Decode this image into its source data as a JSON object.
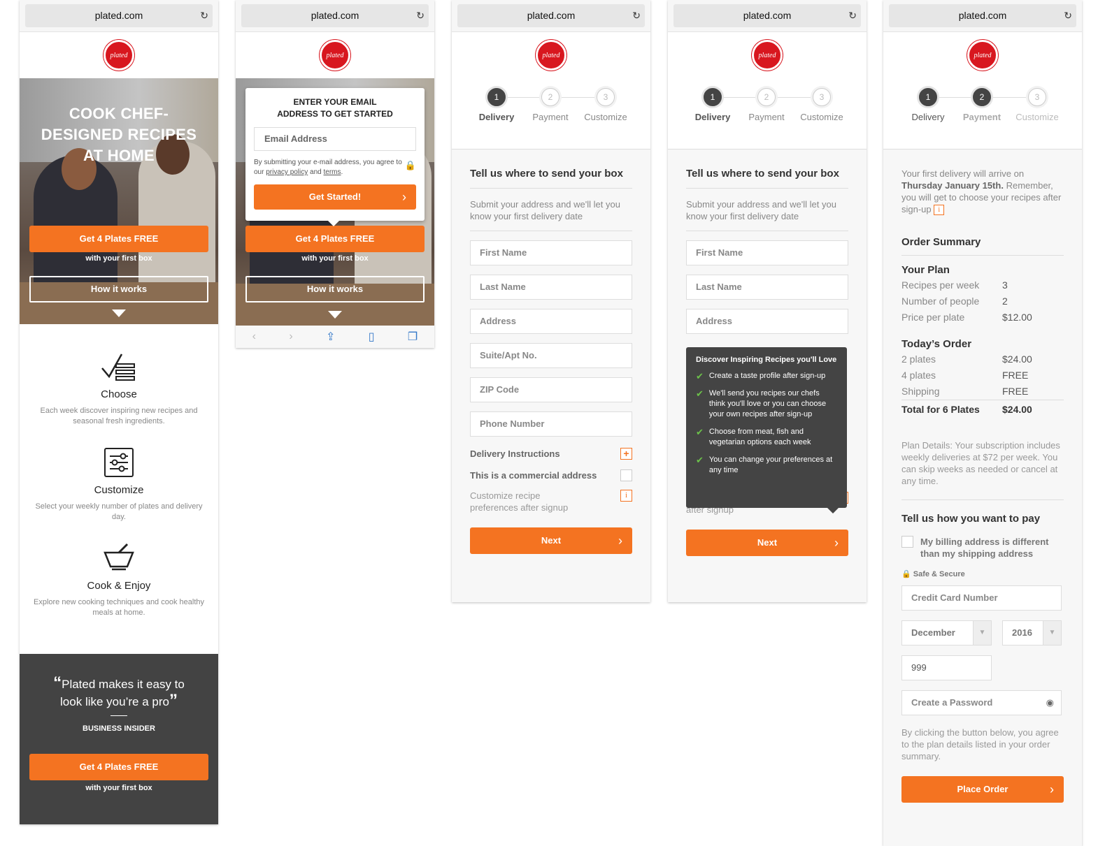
{
  "browser": {
    "url": "plated.com"
  },
  "logo": {
    "text": "plated"
  },
  "landing": {
    "hero_title": "COOK CHEF-DESIGNED RECIPES AT HOME",
    "cta_label": "Get 4 Plates FREE",
    "cta_sub": "with your first box",
    "how_label": "How it works",
    "features": [
      {
        "title": "Choose",
        "desc": "Each week discover inspiring new recipes and seasonal fresh ingredients."
      },
      {
        "title": "Customize",
        "desc": "Select your weekly number of plates and delivery day."
      },
      {
        "title": "Cook & Enjoy",
        "desc": "Explore new cooking techniques and cook healthy meals at home."
      }
    ],
    "quote": "Plated makes it easy to look like you’re a pro",
    "quote_source": "BUSINESS INSIDER"
  },
  "email_modal": {
    "title": "ENTER YOUR EMAIL ADDRESS TO GET STARTED",
    "email_placeholder": "Email Address",
    "legal_prefix": "By submitting your e-mail address, you agree to our",
    "privacy": "privacy policy",
    "and": "and",
    "terms": "terms",
    "go_label": "Get Started!"
  },
  "steps": [
    "Delivery",
    "Payment",
    "Customize"
  ],
  "delivery": {
    "title": "Tell us where to send your box",
    "sub": "Submit your address and we'll let you know your first delivery date",
    "fields": [
      "First Name",
      "Last Name",
      "Address",
      "Suite/Apt No.",
      "ZIP Code",
      "Phone Number"
    ],
    "instructions": "Delivery Instructions",
    "commercial": "This is a commercial address",
    "customize": "Customize recipe preferences after signup",
    "next": "Next"
  },
  "tooltip": {
    "title": "Discover Inspiring Recipes you'll Love",
    "items": [
      "Create a taste profile after sign-up",
      "We'll send you recipes our chefs think you'll love or you can choose your own recipes after sign-up",
      "Choose from meat, fish and vegetarian options each week",
      "You can change your preferences at any time"
    ]
  },
  "payment": {
    "intro_a": "Your first delivery will arrive on",
    "intro_date": "Thursday January 15th.",
    "intro_b": "Remember, you will get to choose your recipes after sign-up",
    "summary_title": "Order Summary",
    "plan_title": "Your Plan",
    "plan": [
      {
        "k": "Recipes per week",
        "v": "3"
      },
      {
        "k": "Number of people",
        "v": "2"
      },
      {
        "k": "Price per plate",
        "v": "$12.00"
      }
    ],
    "order_title": "Today’s Order",
    "order": [
      {
        "k": "2 plates",
        "v": "$24.00"
      },
      {
        "k": "4 plates",
        "v": "FREE"
      },
      {
        "k": "Shipping",
        "v": "FREE"
      }
    ],
    "total_label": "Total for 6 Plates",
    "total_value": "$24.00",
    "plan_details": "Plan Details: Your subscription includes weekly deliveries at $72 per week. You can skip weeks as needed or cancel at any time.",
    "pay_title": "Tell us how you want to pay",
    "billing": "My billing address is different than my shipping address",
    "secure": "Safe & Secure",
    "card_placeholder": "Credit Card Number",
    "month": "December",
    "year": "2016",
    "cvv": "999",
    "password_placeholder": "Create a Password",
    "agree": "By clicking the button below, you agree to the plan details listed in your order summary.",
    "place_order": "Place Order"
  }
}
